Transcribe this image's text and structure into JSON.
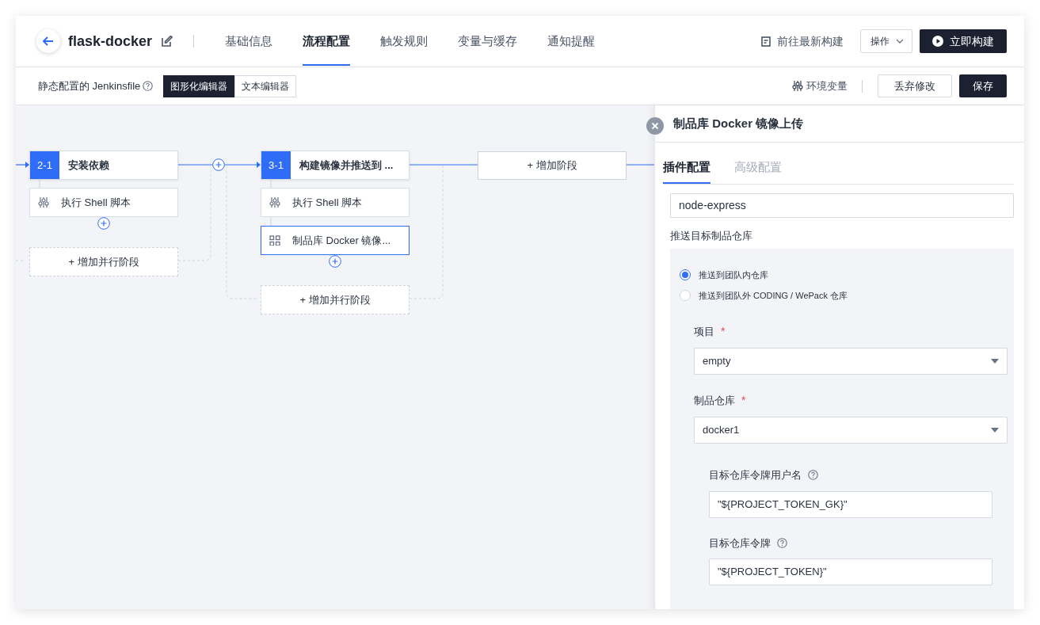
{
  "header": {
    "title": "flask-docker",
    "tabs": [
      {
        "label": "基础信息",
        "selected": false
      },
      {
        "label": "流程配置",
        "selected": true
      },
      {
        "label": "触发规则",
        "selected": false
      },
      {
        "label": "变量与缓存",
        "selected": false
      },
      {
        "label": "通知提醒",
        "selected": false
      }
    ],
    "latest_build_link": "前往最新构建",
    "actions_dropdown": "操作",
    "build_button": "立即构建"
  },
  "toolbar": {
    "label": "静态配置的 Jenkinsfile",
    "editor_modes": [
      {
        "label": "图形化编辑器",
        "selected": true
      },
      {
        "label": "文本编辑器",
        "selected": false
      }
    ],
    "env_vars": "环境变量",
    "discard_button": "丢弃修改",
    "save_button": "保存"
  },
  "pipeline": {
    "stages": [
      {
        "number": "2-1",
        "name": "安装依赖",
        "steps": [
          {
            "name": "执行 Shell 脚本",
            "kind": "shell",
            "selected": false
          }
        ],
        "add_parallel": "+ 增加并行阶段"
      },
      {
        "number": "3-1",
        "name": "构建镜像并推送到 ...",
        "steps": [
          {
            "name": "执行 Shell 脚本",
            "kind": "shell",
            "selected": false
          },
          {
            "name": "制品库 Docker 镜像...",
            "kind": "plugin",
            "selected": true
          }
        ],
        "add_parallel": "+ 增加并行阶段"
      }
    ],
    "add_stage": "+ 增加阶段"
  },
  "panel": {
    "title": "制品库 Docker 镜像上传",
    "tabs": [
      {
        "label": "插件配置",
        "selected": true
      },
      {
        "label": "高级配置",
        "selected": false
      }
    ],
    "image_name": "node-express",
    "target_label": "推送目标制品仓库",
    "target_options": [
      {
        "label": "推送到团队内仓库",
        "selected": true
      },
      {
        "label": "推送到团队外 CODING / WePack 仓库",
        "selected": false
      }
    ],
    "fields": [
      {
        "kind": "select",
        "label": "项目",
        "required_mark": "*",
        "value": "empty"
      },
      {
        "kind": "select",
        "label": "制品仓库",
        "required_mark": "*",
        "value": "docker1"
      },
      {
        "kind": "token",
        "label": "目标仓库令牌用户名",
        "help": true,
        "value": "\"${PROJECT_TOKEN_GK}\""
      },
      {
        "kind": "token",
        "label": "目标仓库令牌",
        "help": true,
        "value": "\"${PROJECT_TOKEN}\""
      }
    ]
  }
}
